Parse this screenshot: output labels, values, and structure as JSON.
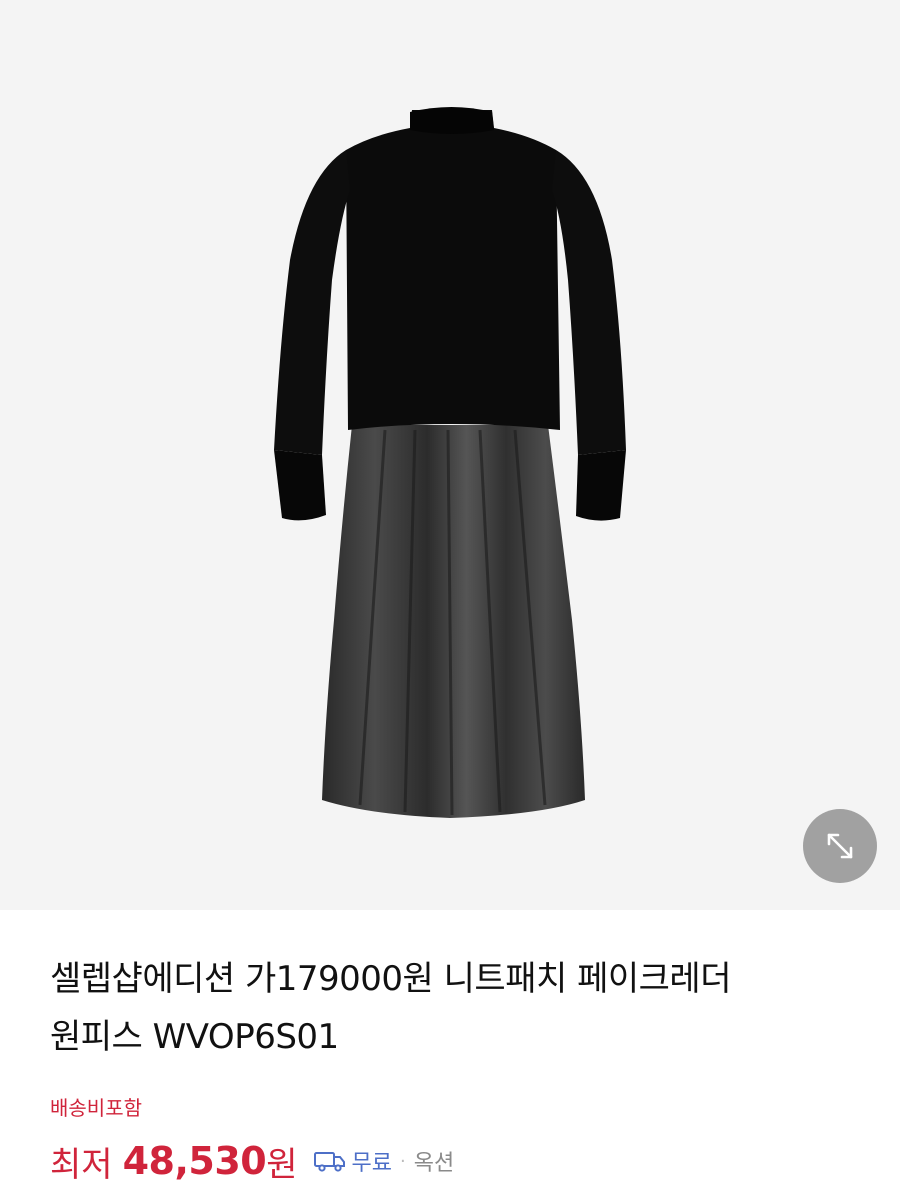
{
  "product": {
    "title_line1": "셀렙샵에디션 가179000원 니트패치 페이크레더",
    "title_line2": "원피스 WVOP6S01",
    "image_alt": "black knit and faux leather dress"
  },
  "shipping": {
    "note": "배송비포함"
  },
  "price": {
    "label": "최저",
    "value": "48,530",
    "unit": "원"
  },
  "delivery": {
    "icon": "truck-icon",
    "text": "무료",
    "separator": "·",
    "market": "옥션"
  },
  "zoom": {
    "icon": "expand-diagonal-icon"
  },
  "colors": {
    "background": "#f4f4f4",
    "price": "#d0243b",
    "delivery": "#4d6fc7",
    "zoom_button": "#9a9a9a"
  }
}
